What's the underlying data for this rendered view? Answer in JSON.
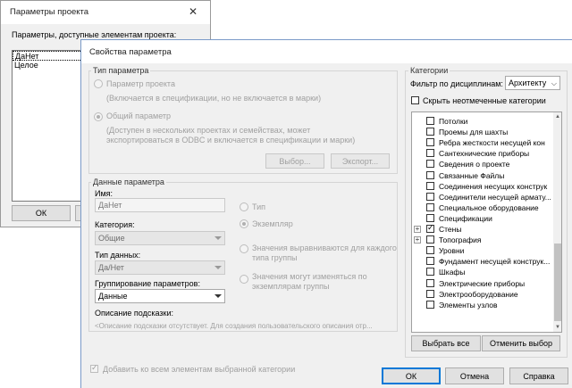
{
  "back_dialog": {
    "title": "Параметры проекта",
    "close_glyph": "✕",
    "available_label": "Параметры, доступные элементам проекта:",
    "list_items": [
      "ДаНет",
      "Целое"
    ],
    "ok": "ОК"
  },
  "dialog": {
    "title": "Свойства параметра",
    "param_type": {
      "legend": "Тип параметра",
      "project_param": "Параметр проекта",
      "project_param_desc": "(Включается в спецификации, но не включается в марки)",
      "shared_param": "Общий параметр",
      "shared_param_desc_1": "(Доступен в нескольких проектах и семействах, может",
      "shared_param_desc_2": "экспортироваться в ODBC и включается в спецификации и марки)",
      "select_button": "Выбор...",
      "export_button": "Экспорт..."
    },
    "param_data": {
      "legend": "Данные параметра",
      "name_label": "Имя:",
      "name_value": "ДаНет",
      "type_radio": "Тип",
      "instance_radio": "Экземпляр",
      "category_label": "Категория:",
      "category_value": "Общие",
      "data_type_label": "Тип данных:",
      "data_type_value": "Да/Нет",
      "group_label": "Группирование параметров:",
      "group_value": "Данные",
      "aligned_1": "Значения выравниваются для каждого",
      "aligned_2": "типа группы",
      "vary_1": "Значения могут изменяться по",
      "vary_2": "экземплярам группы",
      "tooltip_label": "Описание подсказки:",
      "tooltip_value": "<Описание подсказки отсутствует. Для создания пользовательского описания отр..."
    },
    "add_all": "Добавить ко всем элементам выбранной категории",
    "categories": {
      "legend": "Категории",
      "filter_label": "Фильтр по дисциплинам:",
      "filter_value": "Архитекту",
      "hide_unchecked": "Скрыть неотмеченные категории",
      "items": [
        {
          "label": "Потолки",
          "checked": false,
          "expander": false
        },
        {
          "label": "Проемы для шахты",
          "checked": false,
          "expander": false
        },
        {
          "label": "Ребра жесткости несущей кон",
          "checked": false,
          "expander": false
        },
        {
          "label": "Сантехнические приборы",
          "checked": false,
          "expander": false
        },
        {
          "label": "Сведения о проекте",
          "checked": false,
          "expander": false
        },
        {
          "label": "Связанные Файлы",
          "checked": false,
          "expander": false
        },
        {
          "label": "Соединения несущих конструк",
          "checked": false,
          "expander": false
        },
        {
          "label": "Соединители несущей армату...",
          "checked": false,
          "expander": false
        },
        {
          "label": "Специальное оборудование",
          "checked": false,
          "expander": false
        },
        {
          "label": "Спецификации",
          "checked": false,
          "expander": false
        },
        {
          "label": "Стены",
          "checked": true,
          "expander": true
        },
        {
          "label": "Топография",
          "checked": false,
          "expander": true
        },
        {
          "label": "Уровни",
          "checked": false,
          "expander": false
        },
        {
          "label": "Фундамент несущей конструк...",
          "checked": false,
          "expander": false
        },
        {
          "label": "Шкафы",
          "checked": false,
          "expander": false
        },
        {
          "label": "Электрические приборы",
          "checked": false,
          "expander": false
        },
        {
          "label": "Электрооборудование",
          "checked": false,
          "expander": false
        },
        {
          "label": "Элементы узлов",
          "checked": false,
          "expander": false
        }
      ],
      "select_all": "Выбрать все",
      "deselect": "Отменить выбор"
    },
    "ok": "ОК",
    "cancel": "Отмена",
    "help": "Справка"
  }
}
